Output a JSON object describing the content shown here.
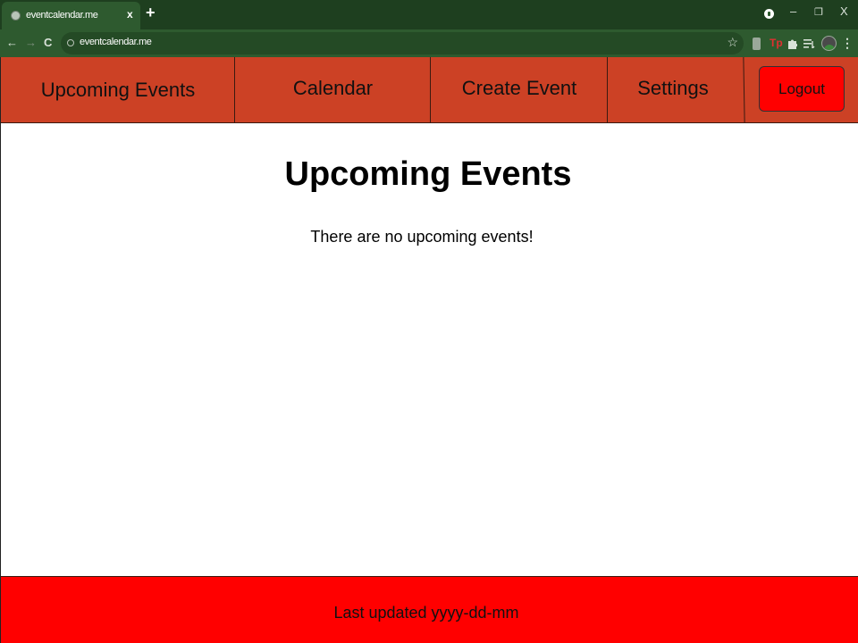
{
  "browser": {
    "tab_title": "eventcalendar.me",
    "tab_close": "x",
    "new_tab": "+",
    "url": "eventcalendar.me",
    "window_controls": {
      "minimize": "–",
      "restore": "❐",
      "close": "X"
    },
    "nav": {
      "back": "←",
      "forward": "→",
      "reload": "C"
    },
    "star": "☆",
    "menu": "⋮",
    "extensions": [
      "puzzle-icon",
      "reading-list-icon"
    ]
  },
  "navbar": {
    "items": [
      {
        "label": "Upcoming Events"
      },
      {
        "label": "Calendar"
      },
      {
        "label": "Create Event"
      },
      {
        "label": "Settings"
      }
    ],
    "logout_label": "Logout"
  },
  "main": {
    "title": "Upcoming Events",
    "empty_message": "There are no upcoming events!"
  },
  "footer": {
    "text": "Last updated yyyy-dd-mm"
  },
  "colors": {
    "navbar": "#cc4125",
    "logout_button": "#ff0000",
    "footer": "#ff0000",
    "browser_frame": "#1e3f1f"
  }
}
